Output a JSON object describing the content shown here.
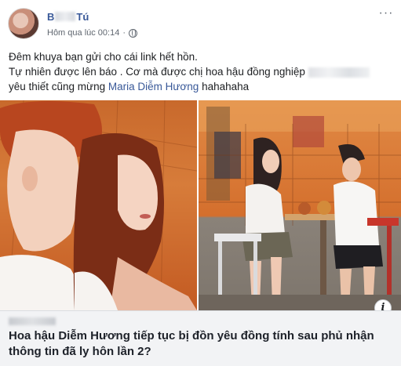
{
  "post": {
    "author_name_visible_start": "B",
    "author_name_visible_end": "Tú",
    "timestamp": "Hôm qua lúc 00:14",
    "separator": "·",
    "privacy_icon": "globe-icon",
    "more_label": "···",
    "text_line1": "Đêm khuya bạn gửi cho cái link hết hồn.",
    "text_line2": "Tự nhiên được lên báo . Cơ mà được chị hoa hậu đồng nghiệp",
    "text_line3_mention": "Maria Diễm Hương",
    "text_line3_prefix": "yêu thiết cũng mừng",
    "text_line3_suffix": "hahahaha"
  },
  "link_preview": {
    "info_label": "i",
    "title": "Hoa hậu Diễm Hương tiếp tục bị đồn yêu đồng tính sau phủ nhận thông tin đã ly hôn lần 2?"
  },
  "colors": {
    "link_blue": "#385898",
    "meta_gray": "#606770",
    "footer_bg": "#f2f3f5"
  }
}
